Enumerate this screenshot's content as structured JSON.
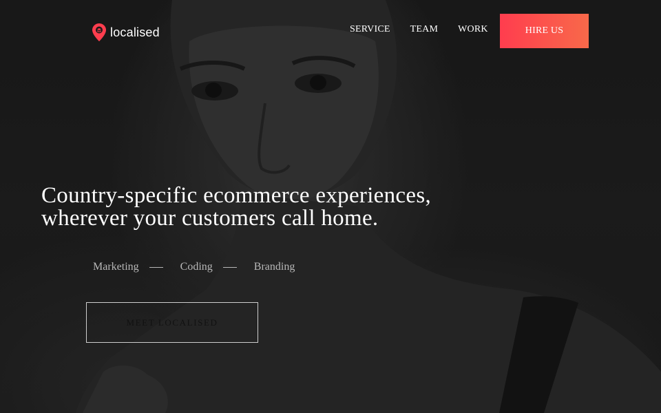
{
  "brand": {
    "name": "localised",
    "accent_color": "#ff3d4e",
    "accent_color_end": "#f8694a",
    "logo_icon": "map-pin-icon"
  },
  "nav": {
    "items": [
      {
        "label": "SERVICE"
      },
      {
        "label": "TEAM"
      },
      {
        "label": "WORK"
      }
    ],
    "cta_label": "HIRE US"
  },
  "hero": {
    "headline": "Country-specific ecommerce experiences, wherever your customers call home.",
    "tags": [
      "Marketing",
      "Coding",
      "Branding"
    ],
    "button_label": "MEET LOCALISED",
    "background": "black-and-white-portrait-photo"
  }
}
